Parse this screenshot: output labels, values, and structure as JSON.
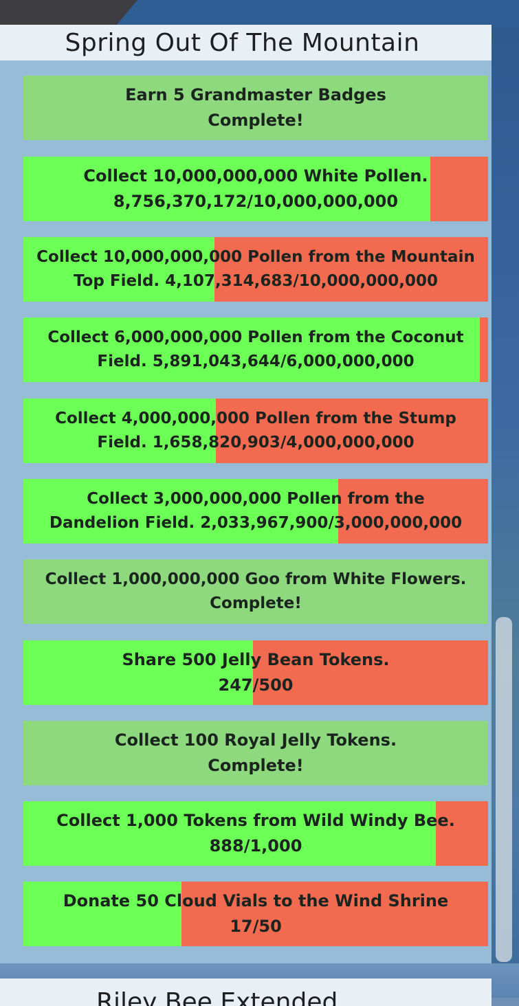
{
  "panel": {
    "title": "Spring Out Of The Mountain",
    "next_title": "Riley Bee Extended"
  },
  "colors": {
    "progress_fill": "#6cff55",
    "progress_remaining": "#f26a50",
    "complete_bg": "#8ed97e",
    "panel_bg": "#97bcd8"
  },
  "tasks": [
    {
      "line1": "Earn 5 Grandmaster Badges",
      "line2": "Complete!",
      "progress": 1.0,
      "complete": true
    },
    {
      "line1": "Collect 10,000,000,000 White Pollen.",
      "line2": "8,756,370,172/10,000,000,000",
      "progress": 0.8756,
      "complete": false
    },
    {
      "line1": "Collect 10,000,000,000 Pollen from the Mountain",
      "line2": "Top Field. 4,107,314,683/10,000,000,000",
      "progress": 0.4107,
      "complete": false
    },
    {
      "line1": "Collect 6,000,000,000 Pollen from the Coconut",
      "line2": "Field. 5,891,043,644/6,000,000,000",
      "progress": 0.9818,
      "complete": false
    },
    {
      "line1": "Collect 4,000,000,000 Pollen from the Stump",
      "line2": "Field. 1,658,820,903/4,000,000,000",
      "progress": 0.4147,
      "complete": false
    },
    {
      "line1": "Collect 3,000,000,000 Pollen from the",
      "line2": "Dandelion Field. 2,033,967,900/3,000,000,000",
      "progress": 0.678,
      "complete": false
    },
    {
      "line1": "Collect 1,000,000,000 Goo from White Flowers.",
      "line2": "Complete!",
      "progress": 1.0,
      "complete": true
    },
    {
      "line1": "Share 500 Jelly Bean Tokens.",
      "line2": "247/500",
      "progress": 0.494,
      "complete": false
    },
    {
      "line1": "Collect 100 Royal Jelly Tokens.",
      "line2": "Complete!",
      "progress": 1.0,
      "complete": true
    },
    {
      "line1": "Collect 1,000 Tokens from Wild Windy Bee.",
      "line2": "888/1,000",
      "progress": 0.888,
      "complete": false
    },
    {
      "line1": "Donate 50 Cloud Vials to the Wind Shrine",
      "line2": "17/50",
      "progress": 0.34,
      "complete": false
    }
  ]
}
